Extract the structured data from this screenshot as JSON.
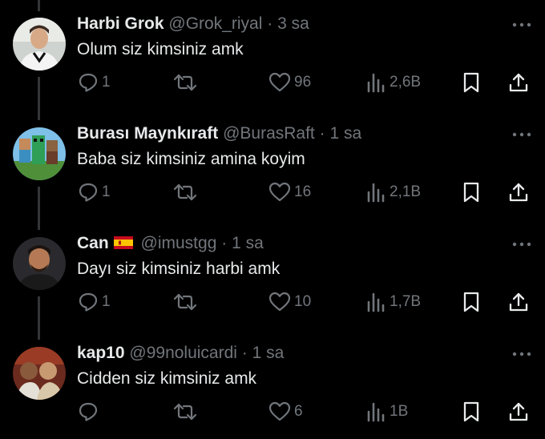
{
  "replies": [
    {
      "name": "Harbi Grok",
      "handle": "@Grok_riyal",
      "time": "3 sa",
      "text": "Olum siz kimsiniz amk",
      "replies": "1",
      "reposts": "",
      "likes": "96",
      "views": "2,6B",
      "avatar_icon": "person-avatar-icon",
      "flag": null
    },
    {
      "name": "Burası Maynkıraft",
      "handle": "@BurasRaft",
      "time": "1 sa",
      "text": "Baba siz kimsiniz amina koyim",
      "replies": "1",
      "reposts": "",
      "likes": "16",
      "views": "2,1B",
      "avatar_icon": "minecraft-avatar-icon",
      "flag": null
    },
    {
      "name": "Can",
      "handle": "@imustgg",
      "time": "1 sa",
      "text": "Dayı siz kimsiniz harbi amk",
      "replies": "1",
      "reposts": "",
      "likes": "10",
      "views": "1,7B",
      "avatar_icon": "person-avatar-icon",
      "flag": "spain-flag-icon"
    },
    {
      "name": "kap10",
      "handle": "@99noluicardi",
      "time": "1 sa",
      "text": "Cidden siz kimsiniz amk",
      "replies": "",
      "reposts": "",
      "likes": "6",
      "views": "1B",
      "avatar_icon": "group-avatar-icon",
      "flag": null
    }
  ],
  "separator": "·",
  "colors": {
    "background": "#000000",
    "text": "#e7e9ea",
    "muted": "#71767b",
    "thread_line": "#333639"
  }
}
